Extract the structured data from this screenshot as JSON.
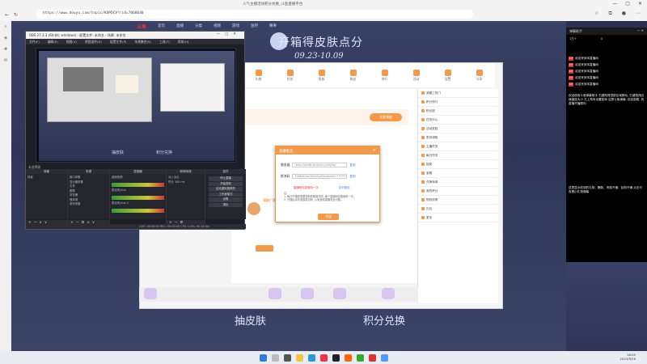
{
  "browser": {
    "tab_title": "人气主播活动积分兑换_斗鱼直播平台",
    "url": "https://www.douyu.com/topic/KOPDCV?rid=7068640",
    "window_controls": [
      "minimize-icon",
      "maximize-icon",
      "close-icon"
    ]
  },
  "site": {
    "logo": "斗鱼",
    "nav": [
      "首页",
      "直播",
      "分类",
      "视频",
      "游戏",
      "鱼吧",
      "赛事"
    ],
    "event_title": "开箱得皮肤点分",
    "event_date": "09.23-10.09",
    "bottom_labels": [
      "抽皮肤",
      "积分兑换"
    ],
    "iconbar": [
      "礼物",
      "任务",
      "贵族",
      "粉丝",
      "排行",
      "活动",
      "设置",
      "分享"
    ],
    "card_button": "立即领取",
    "card_text": "领取广场有新内容",
    "side_list": [
      "我要上热门",
      "积分排行",
      "粉丝团",
      "任务中心",
      "活动奖励",
      "签到领取",
      "主播任务",
      "每日任务",
      "抽奖",
      "宝箱",
      "兑换商城",
      "我的积分",
      "规则说明",
      "礼包",
      "更多"
    ]
  },
  "obs": {
    "title": "OBS 27.2.3 (64-bit, windows) - 配置文件: 未命名 - 场景: 未命名",
    "menu": [
      "文件(F)",
      "编辑(E)",
      "视图(V)",
      "停靠部件(D)",
      "配置文件(P)",
      "场景集合(S)",
      "工具(T)",
      "帮助(H)"
    ],
    "preview_labels": [
      "抽皮肤",
      "积分兑换"
    ],
    "status_label": "未选择源",
    "docks": {
      "scenes": {
        "title": "场景",
        "items": [
          "场景"
        ]
      },
      "sources": {
        "title": "来源",
        "items": [
          "窗口采集",
          "显示器采集",
          "文本",
          "图像",
          "浏览器",
          "媒体源",
          "游戏采集"
        ]
      },
      "mixer": {
        "title": "混音器",
        "items": [
          "桌面音频",
          "麦克风/Aux",
          "麦克风/Aux 2",
          "媒体源"
        ]
      },
      "transitions": {
        "title": "转场特效",
        "items": [
          "淡入淡出",
          "时长 300 ms"
        ]
      },
      "controls": {
        "title": "控件",
        "buttons": [
          "停止直播",
          "开始录制",
          "启动虚拟摄像机",
          "工作室模式",
          "设置",
          "退出"
        ]
      }
    },
    "statusbar": "LIVE: 00:00:00  REC: 00:00:00  CPU: 0.6%, 60.00 fps"
  },
  "dialog": {
    "title": "直播推流",
    "server_label": "服务器",
    "server_value": "rtmp://sendtc3a.douyu.com/live",
    "key_label": "推流码",
    "key_value": "7068640rAi3hG0Zp0?wsSecret=•••••••",
    "copy": "复制",
    "warning": "直播码仅能使用一次",
    "link": "如何使用",
    "notes": [
      "注:",
      "1. 每次开播前需要重新获取推流码, 每个直播码仅能使用一次。",
      "2. 开播后请勿泄露推流码, 以免造成直播安全问题。"
    ],
    "ok": "关闭"
  },
  "danmaku": {
    "title": "弹幕助手",
    "stats": [
      "1万+",
      "0"
    ],
    "messages": [
      {
        "badge": "LV",
        "text": "欢迎来到本直播间"
      },
      {
        "badge": "LV",
        "text": "欢迎来到本直播间"
      },
      {
        "badge": "LV",
        "text": "欢迎来到本直播间"
      },
      {
        "badge": "LV",
        "text": "欢迎来到本直播间"
      },
      {
        "badge": "LV",
        "text": "欢迎来到本直播间"
      }
    ],
    "notice": "欢迎使用斗鱼弹幕助手 右键拖拽顶部区域移动, 右键拖拽边缘缩放大小 右上角有设置菜单 这是斗鱼弹幕, 欢迎观看, 祝直播开播顺利",
    "notice2": "这里显示收到的礼物、酬勤、贵族开通、钻粉开通 点击可查看小礼物弹幕"
  },
  "taskbar": {
    "time": "16:05",
    "date": "2023/9/26"
  }
}
